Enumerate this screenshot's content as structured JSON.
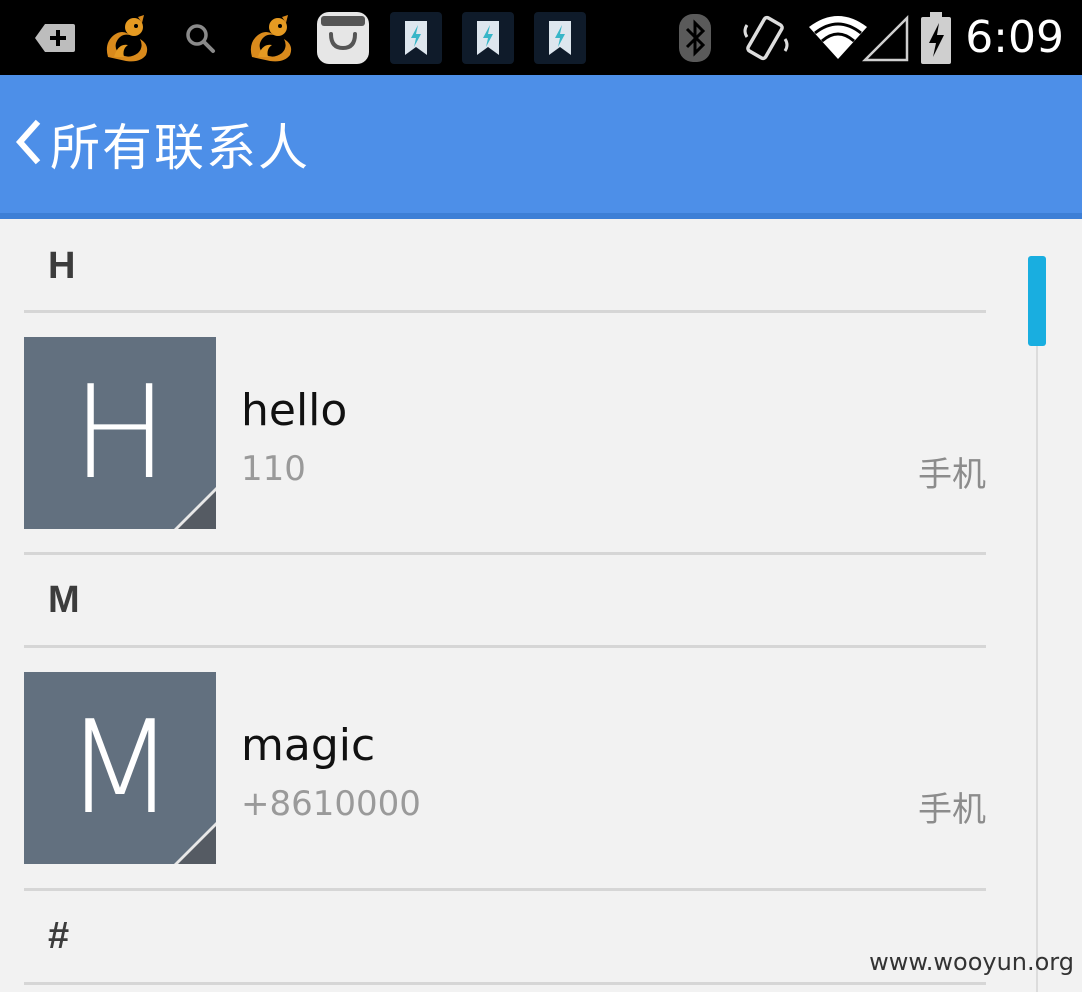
{
  "status_bar": {
    "time": "6:09",
    "icons": [
      "add-notification-icon",
      "uc-browser-icon",
      "search-icon",
      "uc-browser-icon",
      "shopping-bag-icon",
      "bookmark-flash-icon",
      "bookmark-flash-icon",
      "bookmark-flash-icon",
      "bluetooth-icon",
      "vibrate-icon",
      "wifi-icon",
      "signal-icon",
      "battery-charging-icon"
    ]
  },
  "action_bar": {
    "title": "所有联系人"
  },
  "sections": [
    {
      "letter": "H"
    },
    {
      "letter": "M"
    },
    {
      "letter": "#"
    }
  ],
  "contacts": [
    {
      "avatar_letter": "H",
      "name": "hello",
      "number": "110",
      "type": "手机"
    },
    {
      "avatar_letter": "M",
      "name": "magic",
      "number": "+8610000",
      "type": "手机"
    }
  ],
  "watermark": "www.wooyun.org",
  "colors": {
    "action_bar": "#4d8fe8",
    "avatar": "#62707f",
    "scroll_thumb": "#19aee0",
    "background": "#f2f2f2"
  }
}
